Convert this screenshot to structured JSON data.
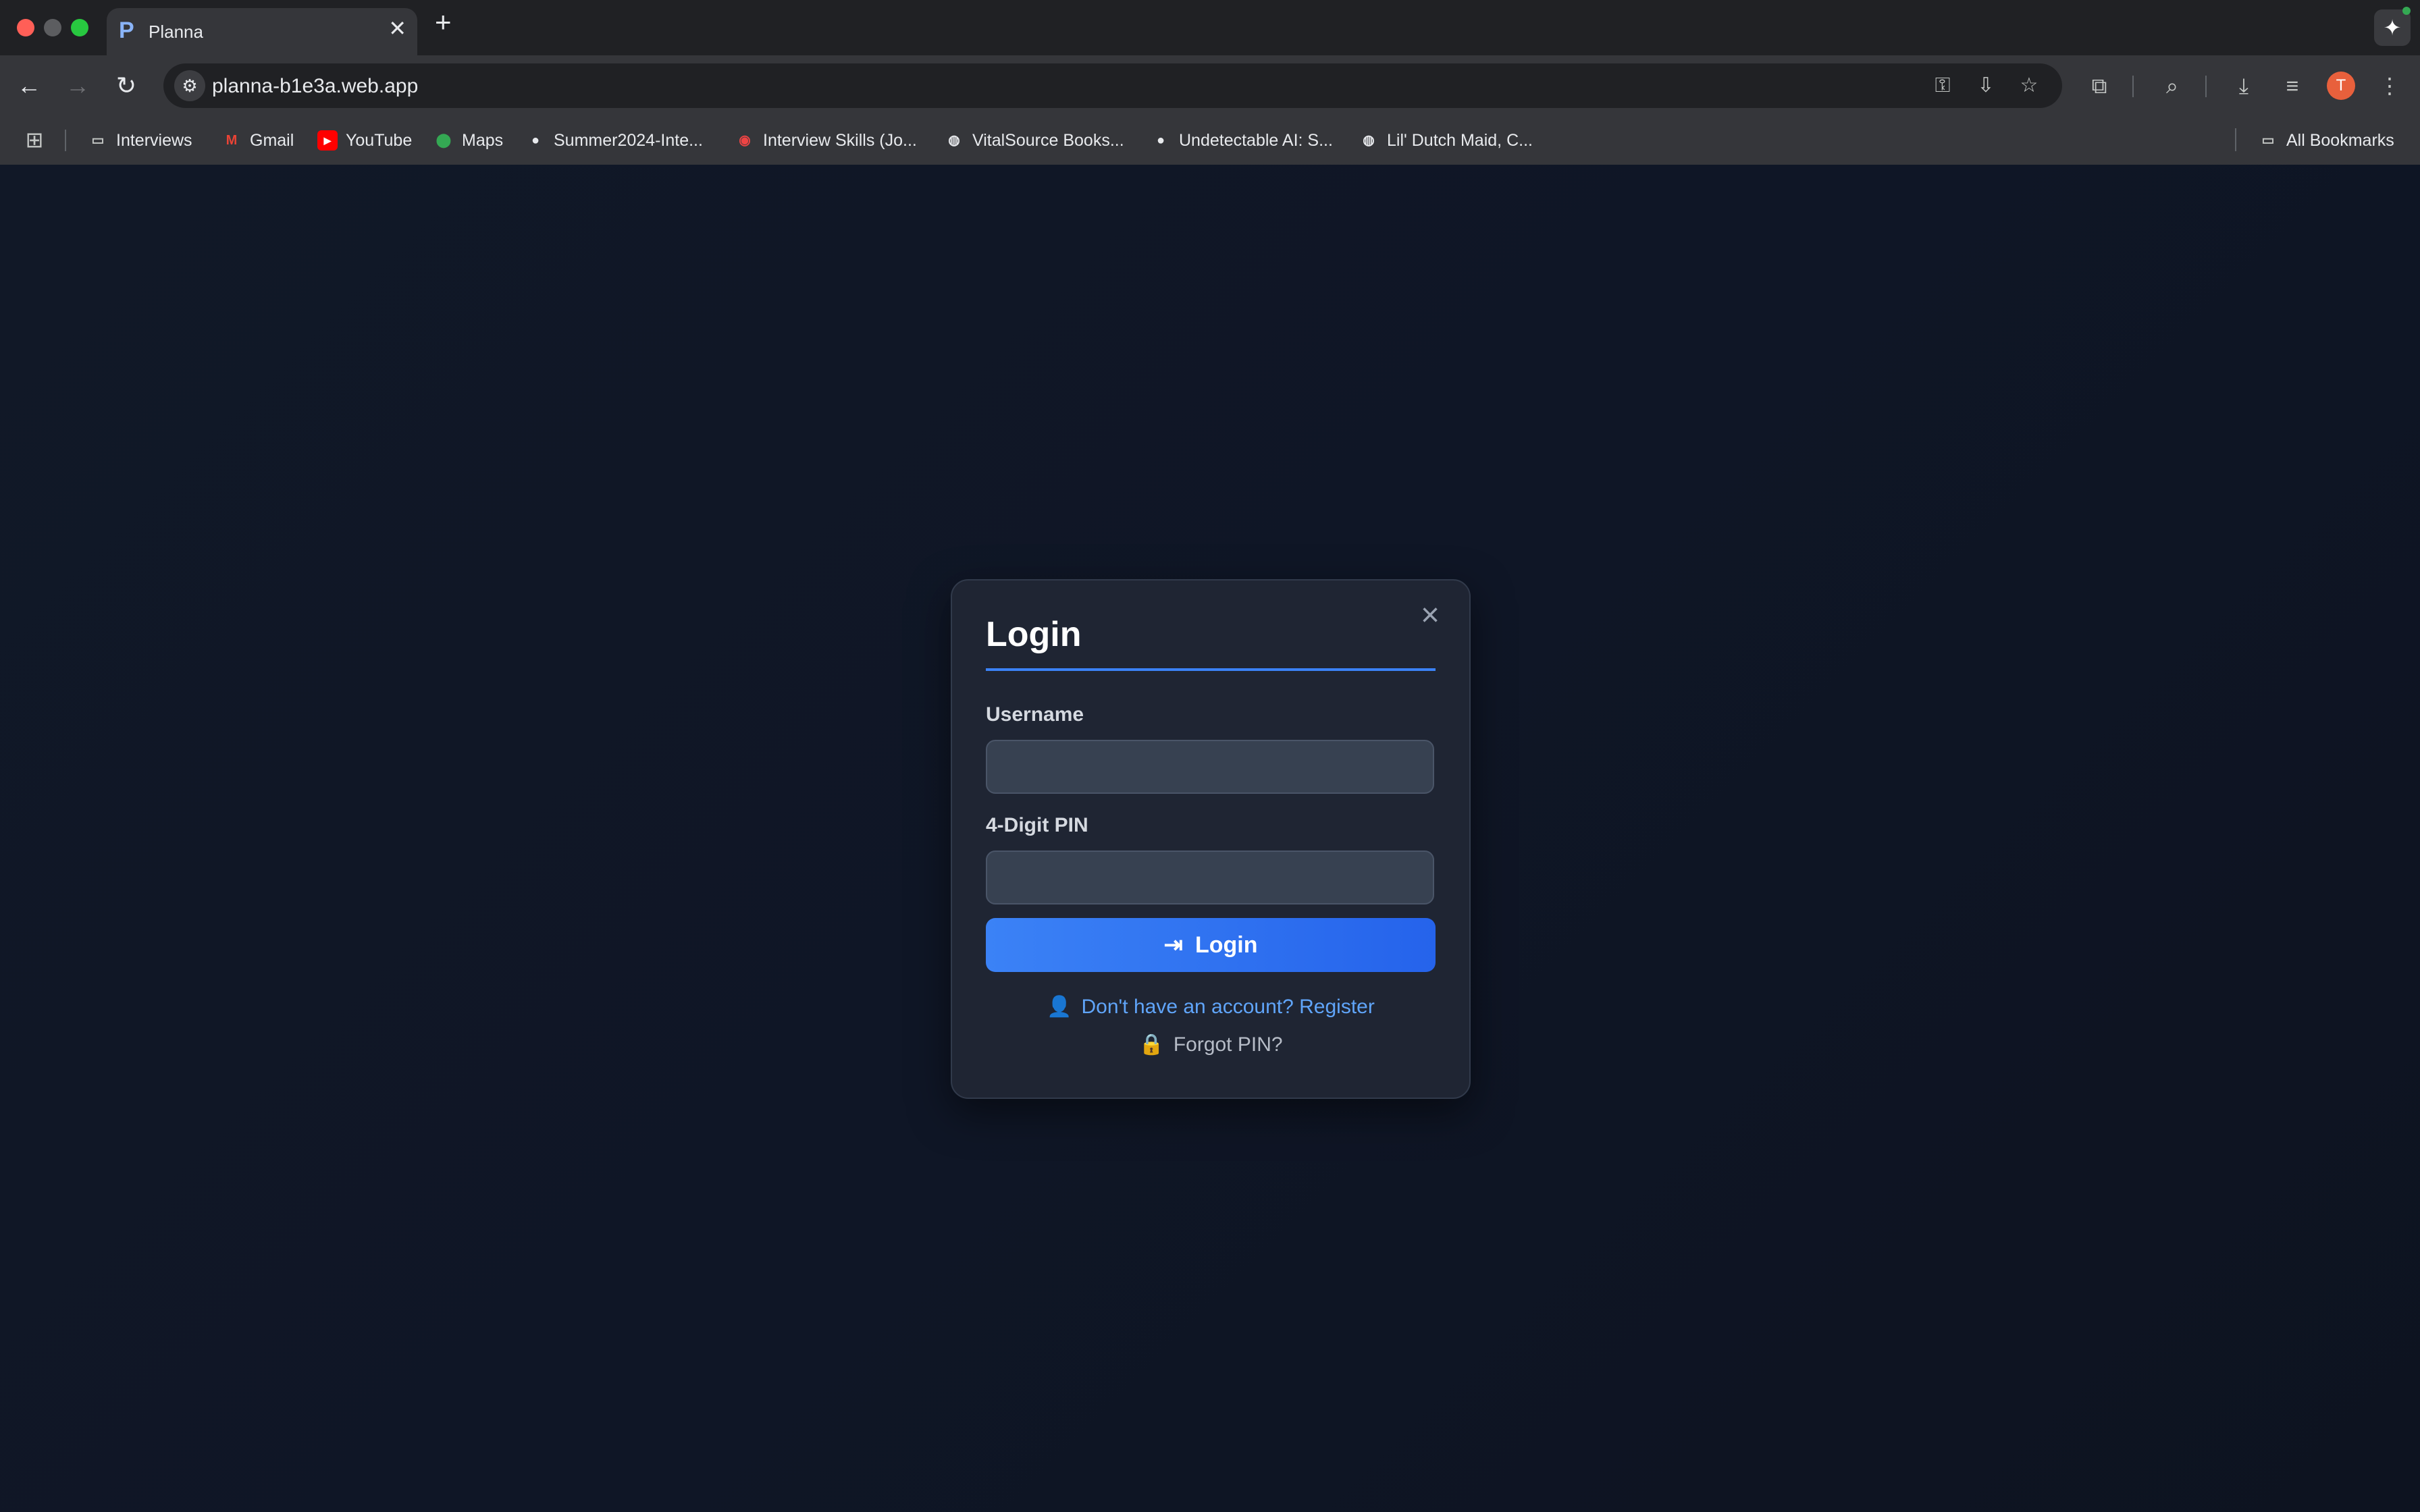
{
  "browser": {
    "tab": {
      "favicon": "P",
      "title": "Planna",
      "close": "✕"
    },
    "new_tab": "+",
    "url": "planna-b1e3a.web.app",
    "avatar_initial": "T",
    "bookmarks": [
      {
        "label": "Interviews",
        "icon": "folder-icon"
      },
      {
        "label": "Gmail",
        "icon": "gmail-icon"
      },
      {
        "label": "YouTube",
        "icon": "youtube-icon"
      },
      {
        "label": "Maps",
        "icon": "maps-icon"
      },
      {
        "label": "Summer2024-Inte...",
        "icon": "github-icon"
      },
      {
        "label": "Interview Skills (Jo...",
        "icon": "site-icon"
      },
      {
        "label": "VitalSource Books...",
        "icon": "globe-icon"
      },
      {
        "label": "Undetectable AI: S...",
        "icon": "site-icon"
      },
      {
        "label": "Lil' Dutch Maid, C...",
        "icon": "globe-icon"
      }
    ],
    "all_bookmarks": "All Bookmarks"
  },
  "login": {
    "title": "Login",
    "username_label": "Username",
    "username_value": "",
    "pin_label": "4-Digit PIN",
    "pin_value": "",
    "submit_label": "Login",
    "register_link": "Don't have an account? Register",
    "forgot_link": "Forgot PIN?"
  },
  "colors": {
    "page_bg": "#0f1420",
    "card_bg": "#1f2533",
    "accent": "#3b82f6",
    "link": "#60a5fa"
  }
}
